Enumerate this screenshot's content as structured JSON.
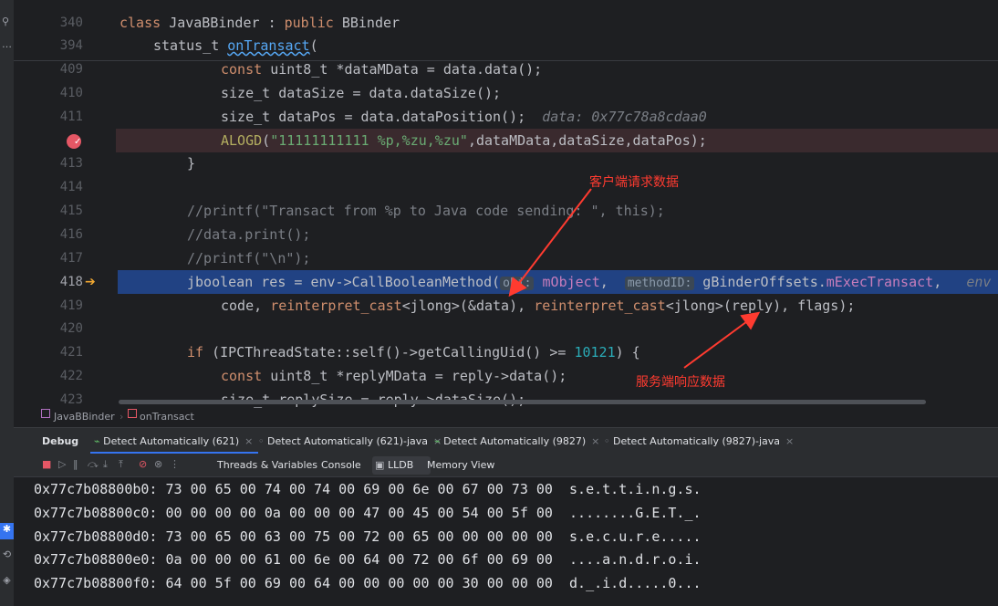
{
  "editor": {
    "sticky": [
      {
        "num": "340",
        "code": [
          {
            "t": "class ",
            "c": "kw"
          },
          {
            "t": "JavaBBinder ",
            "c": "ty"
          },
          {
            "t": ": ",
            "c": "ty"
          },
          {
            "t": "public ",
            "c": "kw"
          },
          {
            "t": "BBinder",
            "c": "ty"
          }
        ],
        "indent": 0
      },
      {
        "num": "394",
        "code": [
          {
            "t": "status_t ",
            "c": "ty"
          },
          {
            "t": "onTransact",
            "c": "fnu"
          },
          {
            "t": "(",
            "c": "ty"
          }
        ],
        "indent": 1
      }
    ],
    "lines": [
      {
        "num": "409",
        "indent": 3,
        "code": [
          {
            "t": "const ",
            "c": "kw"
          },
          {
            "t": "uint8_t ",
            "c": "ty"
          },
          {
            "t": "*dataMData = data.data();",
            "c": "ty"
          }
        ]
      },
      {
        "num": "410",
        "indent": 3,
        "code": [
          {
            "t": "size_t dataSize = data.dataSize();",
            "c": "ty"
          }
        ]
      },
      {
        "num": "411",
        "indent": 3,
        "code": [
          {
            "t": "size_t dataPos = data.dataPosition();",
            "c": "ty"
          },
          {
            "t": "  data: 0x77c78a8cdaa0",
            "c": "inl"
          }
        ]
      },
      {
        "num": "",
        "indent": 3,
        "type": "breakpoint",
        "code": [
          {
            "t": "ALOGD",
            "c": "mac"
          },
          {
            "t": "(",
            "c": "ty"
          },
          {
            "t": "\"11111111111 %p,%zu,%zu\"",
            "c": "st"
          },
          {
            "t": ",dataMData,dataSize,dataPos);",
            "c": "ty"
          }
        ]
      },
      {
        "num": "413",
        "indent": 2,
        "code": [
          {
            "t": "}",
            "c": "ty"
          }
        ]
      },
      {
        "num": "414",
        "indent": 2,
        "code": []
      },
      {
        "num": "415",
        "indent": 2,
        "code": [
          {
            "t": "//printf(\"Transact from %p to Java code sending: \", this);",
            "c": "cm"
          }
        ]
      },
      {
        "num": "416",
        "indent": 2,
        "code": [
          {
            "t": "//data.print();",
            "c": "cm"
          }
        ]
      },
      {
        "num": "417",
        "indent": 2,
        "code": [
          {
            "t": "//printf(\"\\n\");",
            "c": "cm"
          }
        ]
      },
      {
        "num": "418",
        "indent": 2,
        "type": "current",
        "code": [
          {
            "t": "jboolean res = env->CallBooleanMethod(",
            "c": "ty"
          },
          {
            "t": "obj:",
            "c": "hint"
          },
          {
            "t": " mObject",
            "c": "fld"
          },
          {
            "t": ",  ",
            "c": "ty"
          },
          {
            "t": "methodID:",
            "c": "hint"
          },
          {
            "t": " gBinderOffsets.",
            "c": "ty"
          },
          {
            "t": "mExecTransact",
            "c": "fld"
          },
          {
            "t": ",   ",
            "c": "ty"
          },
          {
            "t": "env",
            "c": "inl"
          }
        ]
      },
      {
        "num": "419",
        "indent": 3,
        "code": [
          {
            "t": "code, ",
            "c": "ty"
          },
          {
            "t": "reinterpret_cast",
            "c": "kw"
          },
          {
            "t": "<jlong>(&data), ",
            "c": "ty"
          },
          {
            "t": "reinterpret_cast",
            "c": "kw"
          },
          {
            "t": "<jlong>(reply), flags);",
            "c": "ty"
          }
        ]
      },
      {
        "num": "420",
        "indent": 2,
        "code": []
      },
      {
        "num": "421",
        "indent": 2,
        "code": [
          {
            "t": "if ",
            "c": "kw"
          },
          {
            "t": "(IPCThreadState::self()->getCallingUid() >= ",
            "c": "ty"
          },
          {
            "t": "10121",
            "c": "num"
          },
          {
            "t": ") {",
            "c": "ty"
          }
        ]
      },
      {
        "num": "422",
        "indent": 3,
        "code": [
          {
            "t": "const ",
            "c": "kw"
          },
          {
            "t": "uint8_t ",
            "c": "ty"
          },
          {
            "t": "*replyMData = reply->data();",
            "c": "ty"
          }
        ]
      },
      {
        "num": "423",
        "indent": 3,
        "code": [
          {
            "t": "size_t replySize = reply->dataSize();",
            "c": "ty"
          }
        ]
      }
    ]
  },
  "annotations": {
    "client_request": "客户端请求数据",
    "server_response": "服务端响应数据"
  },
  "breadcrumb": {
    "class_name": "JavaBBinder",
    "separator": "›",
    "method_name": "onTransact"
  },
  "debug_tabs": {
    "title": "Debug",
    "tabs": [
      {
        "label": "Detect Automatically (621)"
      },
      {
        "label": "Detect Automatically (621)-java"
      },
      {
        "label": "Detect Automatically (9827)"
      },
      {
        "label": "Detect Automatically (9827)-java"
      }
    ]
  },
  "toolbar": {
    "threads": "Threads & Variables",
    "console": "Console",
    "lldb": "LLDB",
    "memory": "Memory View"
  },
  "memory": [
    {
      "addr": "0x77c7b08800b0:",
      "bytes": "73 00 65 00 74 00 74 00 69 00 6e 00 67 00 73 00",
      "ascii": "s.e.t.t.i.n.g.s."
    },
    {
      "addr": "0x77c7b08800c0:",
      "bytes": "00 00 00 00 0a 00 00 00 47 00 45 00 54 00 5f 00",
      "ascii": "........G.E.T._."
    },
    {
      "addr": "0x77c7b08800d0:",
      "bytes": "73 00 65 00 63 00 75 00 72 00 65 00 00 00 00 00",
      "ascii": "s.e.c.u.r.e....."
    },
    {
      "addr": "0x77c7b08800e0:",
      "bytes": "0a 00 00 00 61 00 6e 00 64 00 72 00 6f 00 69 00",
      "ascii": "....a.n.d.r.o.i."
    },
    {
      "addr": "0x77c7b08800f0:",
      "bytes": "64 00 5f 00 69 00 64 00 00 00 00 00 30 00 00 00",
      "ascii": "d._.i.d.....0..."
    }
  ],
  "colors": {
    "arrow": "#ff3b30",
    "current_line": "#214283",
    "breakpoint_line": "#3a2a2e"
  }
}
